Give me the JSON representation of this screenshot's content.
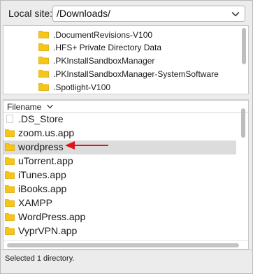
{
  "local_site": {
    "label": "Local site:",
    "path": "/Downloads/"
  },
  "tree": {
    "items": [
      {
        "name": ".DocumentRevisions-V100"
      },
      {
        "name": ".HFS+ Private Directory Data"
      },
      {
        "name": ".PKInstallSandboxManager"
      },
      {
        "name": ".PKInstallSandboxManager-SystemSoftware"
      },
      {
        "name": ".Spotlight-V100"
      }
    ]
  },
  "file_list": {
    "column_header": "Filename",
    "sort_icon": "chevron-down-icon",
    "rows": [
      {
        "name": ".DS_Store",
        "type": "file",
        "selected": false
      },
      {
        "name": "zoom.us.app",
        "type": "folder",
        "selected": false
      },
      {
        "name": "wordpress",
        "type": "folder",
        "selected": true
      },
      {
        "name": "uTorrent.app",
        "type": "folder",
        "selected": false
      },
      {
        "name": "iTunes.app",
        "type": "folder",
        "selected": false
      },
      {
        "name": "iBooks.app",
        "type": "folder",
        "selected": false
      },
      {
        "name": "XAMPP",
        "type": "folder",
        "selected": false
      },
      {
        "name": "WordPress.app",
        "type": "folder",
        "selected": false
      },
      {
        "name": "VyprVPN.app",
        "type": "folder",
        "selected": false
      }
    ]
  },
  "status": {
    "text": "Selected 1 directory."
  },
  "colors": {
    "folder": "#f6c515",
    "selection": "#dcdcdc",
    "annotation_arrow": "#e0141e"
  }
}
